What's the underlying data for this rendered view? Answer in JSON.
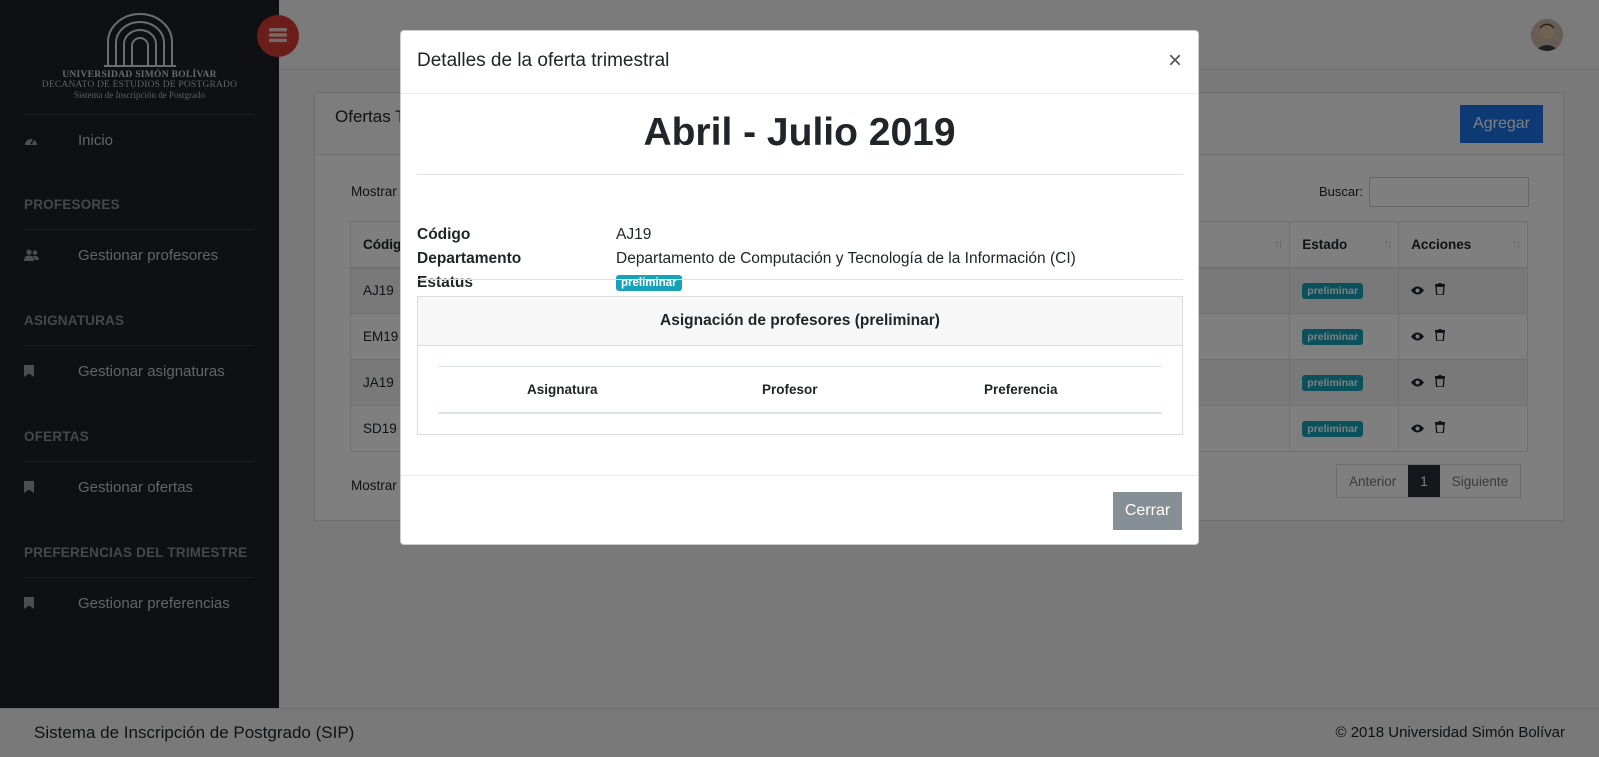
{
  "logo": {
    "line1": "UNIVERSIDAD SIMÓN BOLÍVAR",
    "line2": "DECANATO DE ESTUDIOS DE POSTGRADO",
    "line3": "Sistema de Inscripción de Postgrado"
  },
  "sidebar": {
    "home_label": "Inicio",
    "sections": [
      {
        "heading": "PROFESORES",
        "item": "Gestionar profesores",
        "icon": "users-icon"
      },
      {
        "heading": "ASIGNATURAS",
        "item": "Gestionar asignaturas",
        "icon": "bookmark-icon"
      },
      {
        "heading": "OFERTAS",
        "item": "Gestionar ofertas",
        "icon": "bookmark-icon"
      },
      {
        "heading": "PREFERENCIAS DEL TRIMESTRE",
        "item": "Gestionar preferencias",
        "icon": "bookmark-icon"
      }
    ]
  },
  "main": {
    "title": "Ofertas T",
    "add_label": "Agregar",
    "show_top": "Mostrar",
    "search_label": "Buscar:",
    "columns": [
      "Códig",
      "",
      "Estado",
      "Acciones"
    ],
    "rows": [
      {
        "code": "AJ19",
        "status": "preliminar"
      },
      {
        "code": "EM19",
        "status": "preliminar"
      },
      {
        "code": "JA19",
        "status": "preliminar"
      },
      {
        "code": "SD19",
        "status": "preliminar"
      }
    ],
    "show_bottom": "Mostrar",
    "pager": {
      "prev": "Anterior",
      "current": "1",
      "next": "Siguiente"
    }
  },
  "footer": {
    "left": "Sistema de Inscripción de Postgrado (SIP)",
    "right": "© 2018 Universidad Simón Bolívar"
  },
  "modal": {
    "title": "Detalles de la oferta trimestral",
    "close_symbol": "×",
    "heading": "Abril - Julio 2019",
    "fields": {
      "code_label": "Código",
      "code_value": "AJ19",
      "dept_label": "Departamento",
      "dept_value": "Departamento de Computación y Tecnología de la Información (CI)",
      "status_label": "Estatus",
      "status_value": "preliminar"
    },
    "assignment": {
      "title": "Asignación de profesores (preliminar)",
      "columns": [
        "Asignatura",
        "Profesor",
        "Preferencia"
      ]
    },
    "close_label": "Cerrar"
  },
  "colors": {
    "sidebar_bg": "#1e2129",
    "accent_red": "#d63b33",
    "primary": "#1a73e8",
    "badge_info": "#17a2b8",
    "btn_secondary": "#868e96"
  }
}
